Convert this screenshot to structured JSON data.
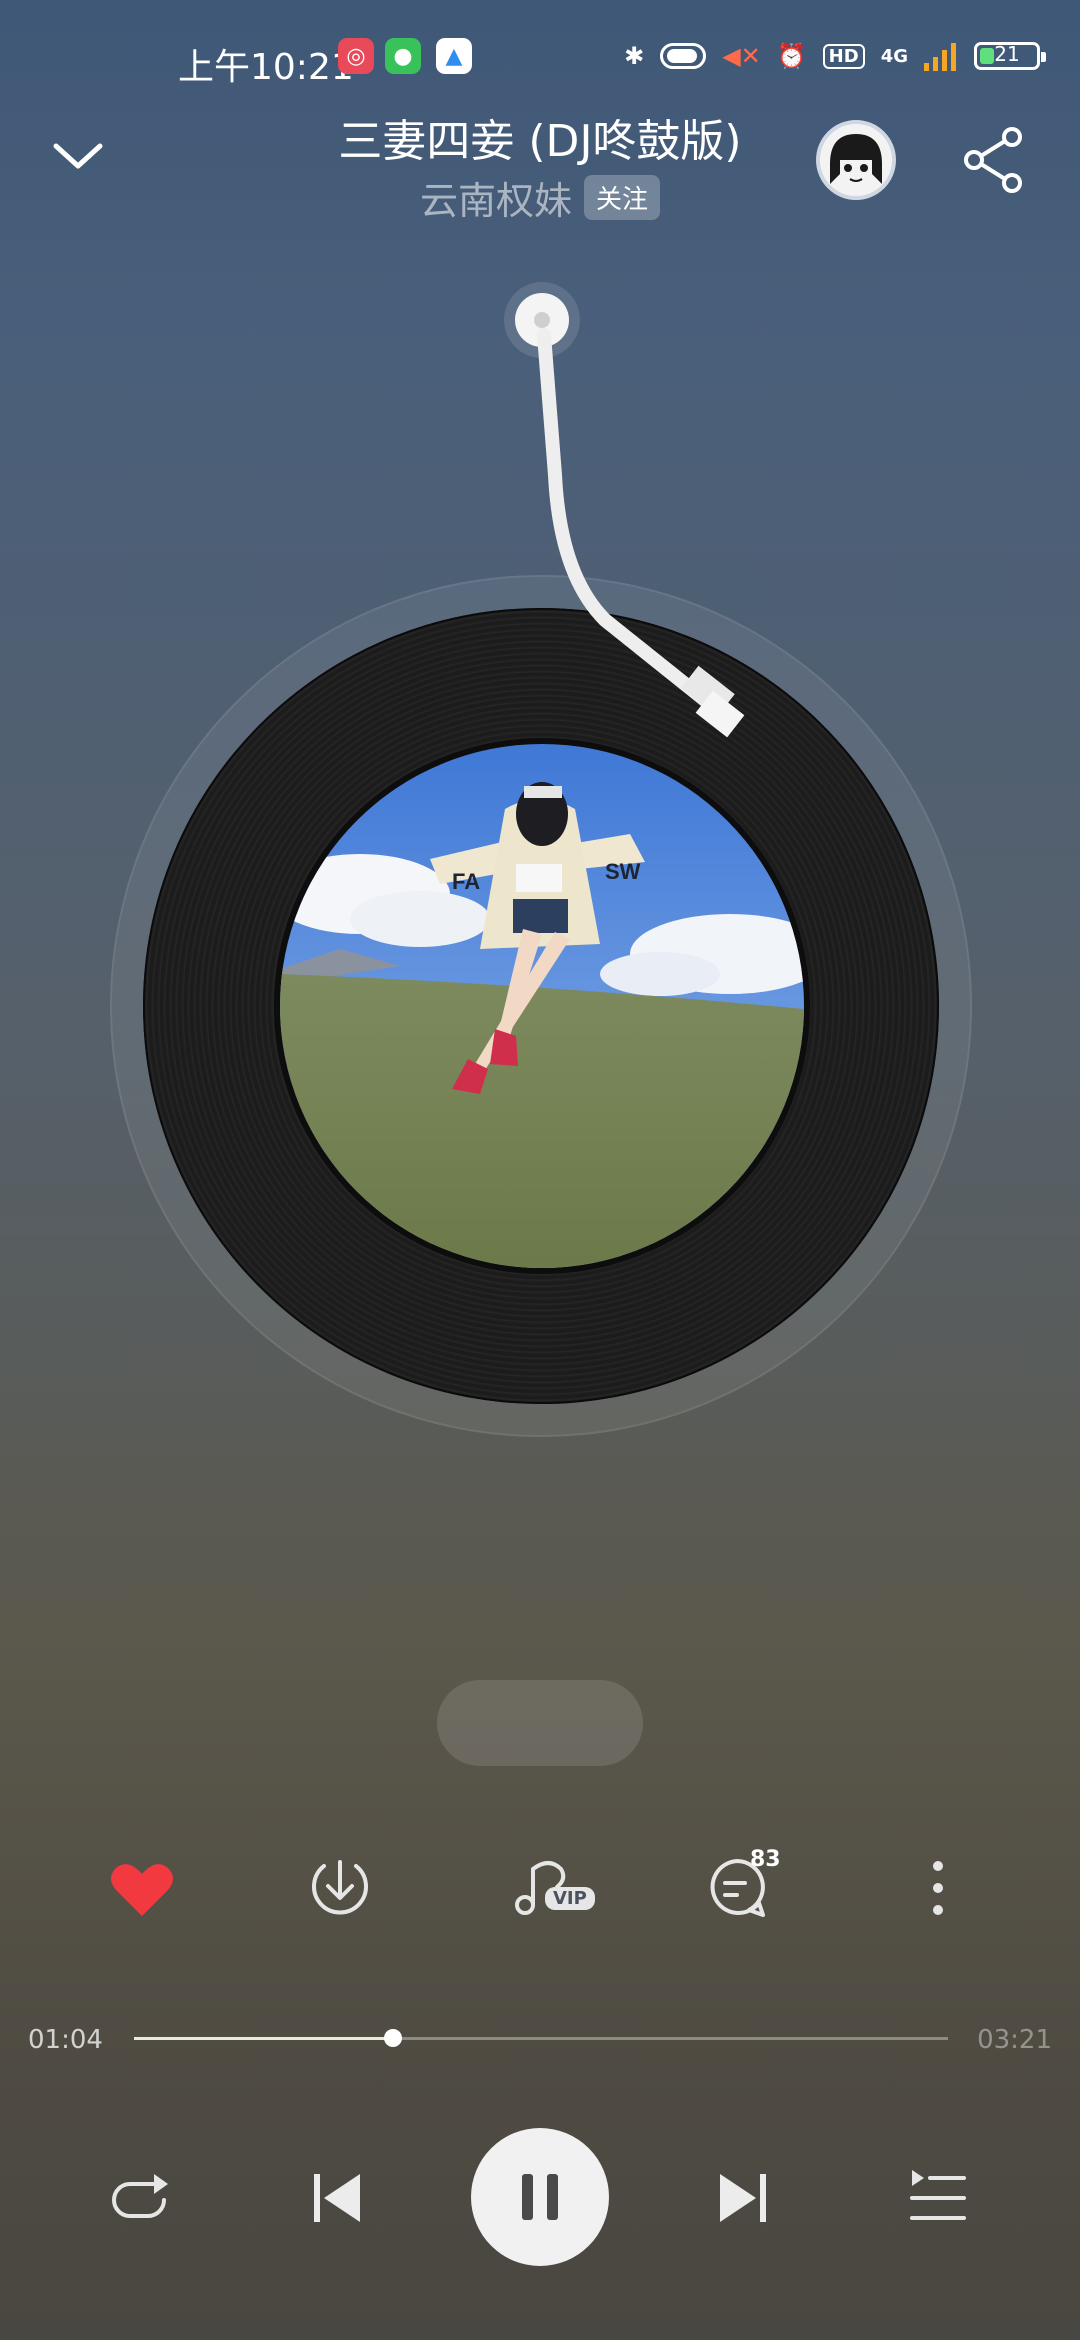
{
  "status_bar": {
    "time": "上午10:21",
    "network": "4G",
    "battery": "21",
    "hd": "HD"
  },
  "header": {
    "song_title": "三妻四妾 (DJ咚鼓版)",
    "artist": "云南权妹",
    "follow_label": "关注"
  },
  "actions": {
    "comment_count": "83",
    "vip_label": "VIP"
  },
  "progress": {
    "current": "01:04",
    "total": "03:21",
    "fraction": 0.318
  },
  "colors": {
    "like": "#f2393f",
    "battery": "#5fe07d"
  }
}
